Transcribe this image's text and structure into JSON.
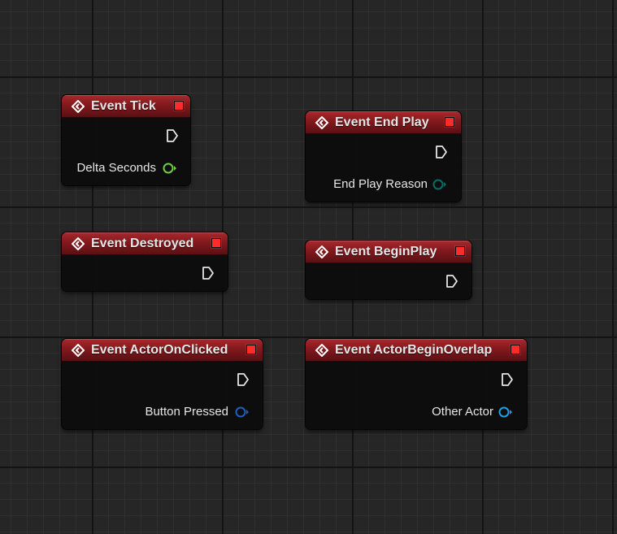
{
  "graph": {
    "nodes": [
      {
        "id": "event-tick",
        "title": "Event Tick",
        "outputs": [
          {
            "label": "Delta Seconds",
            "pin_color": "#6fcf3c",
            "pin_type": "float"
          }
        ]
      },
      {
        "id": "event-end-play",
        "title": "Event End Play",
        "outputs": [
          {
            "label": "End Play Reason",
            "pin_color": "#0d6b67",
            "pin_type": "enum"
          }
        ]
      },
      {
        "id": "event-destroyed",
        "title": "Event Destroyed",
        "outputs": []
      },
      {
        "id": "event-begin-play",
        "title": "Event BeginPlay",
        "outputs": []
      },
      {
        "id": "event-actor-on-clicked",
        "title": "Event ActorOnClicked",
        "outputs": [
          {
            "label": "Button Pressed",
            "pin_color": "#1e5fbf",
            "pin_type": "struct"
          }
        ]
      },
      {
        "id": "event-actor-begin-overlap",
        "title": "Event ActorBeginOverlap",
        "outputs": [
          {
            "label": "Other Actor",
            "pin_color": "#1ea0e6",
            "pin_type": "object"
          }
        ]
      }
    ]
  },
  "colors": {
    "header_red": "#a8292e",
    "delegate_pin": "#ff2a2a",
    "exec_pin": "#e6e6e6",
    "canvas_bg": "#262626"
  },
  "icons": {
    "event": "event-diamond-icon",
    "exec": "exec-output-pin-icon",
    "delegate": "delegate-output-pin-icon"
  }
}
